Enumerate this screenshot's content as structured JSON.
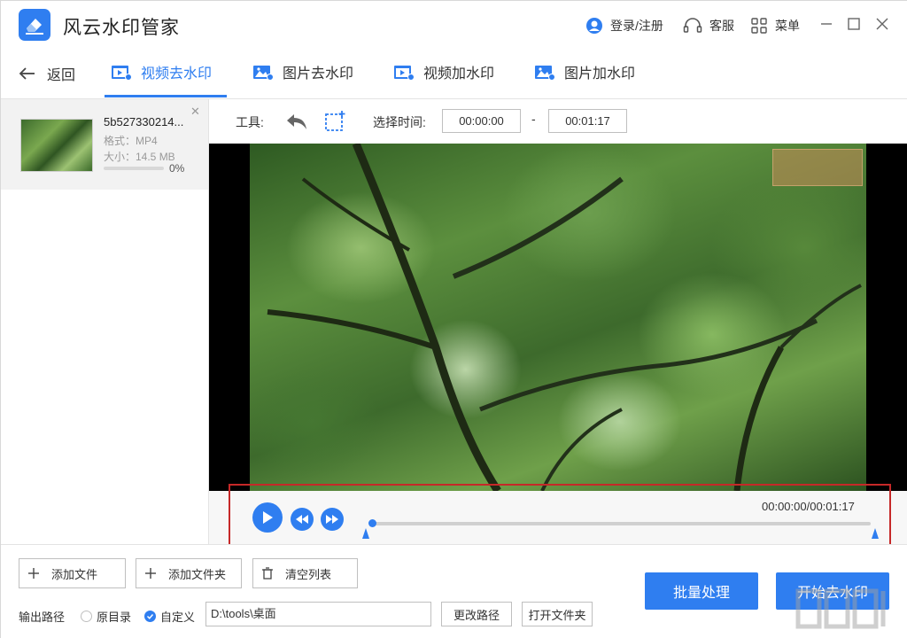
{
  "app": {
    "title": "风云水印管家"
  },
  "titlebar": {
    "login": "登录/注册",
    "service": "客服",
    "menu": "菜单"
  },
  "nav": {
    "back": "返回",
    "tabs": [
      {
        "label": "视频去水印",
        "active": true
      },
      {
        "label": "图片去水印",
        "active": false
      },
      {
        "label": "视频加水印",
        "active": false
      },
      {
        "label": "图片加水印",
        "active": false
      }
    ]
  },
  "file": {
    "name": "5b527330214...",
    "format": "格式：MP4",
    "size": "大小：14.5 MB",
    "progress_percent": 0,
    "progress_text": "0%"
  },
  "tools": {
    "label": "工具:",
    "select_time_label": "选择时间:",
    "start_time": "00:00:00",
    "end_time": "00:01:17",
    "dash": "-"
  },
  "player": {
    "timecode": "00:00:00/00:01:17",
    "position_fraction": 0
  },
  "bottom": {
    "add_file": "添加文件",
    "add_folder": "添加文件夹",
    "clear_list": "清空列表",
    "output_label": "输出路径",
    "option_original": "原目录",
    "option_custom": "自定义",
    "selected_option": "custom",
    "path": "D:\\tools\\桌面",
    "change_path": "更改路径",
    "open_folder": "打开文件夹",
    "batch": "批量处理",
    "start": "开始去水印"
  },
  "colors": {
    "accent": "#2f7ef0",
    "highlight_border": "#c62828"
  }
}
